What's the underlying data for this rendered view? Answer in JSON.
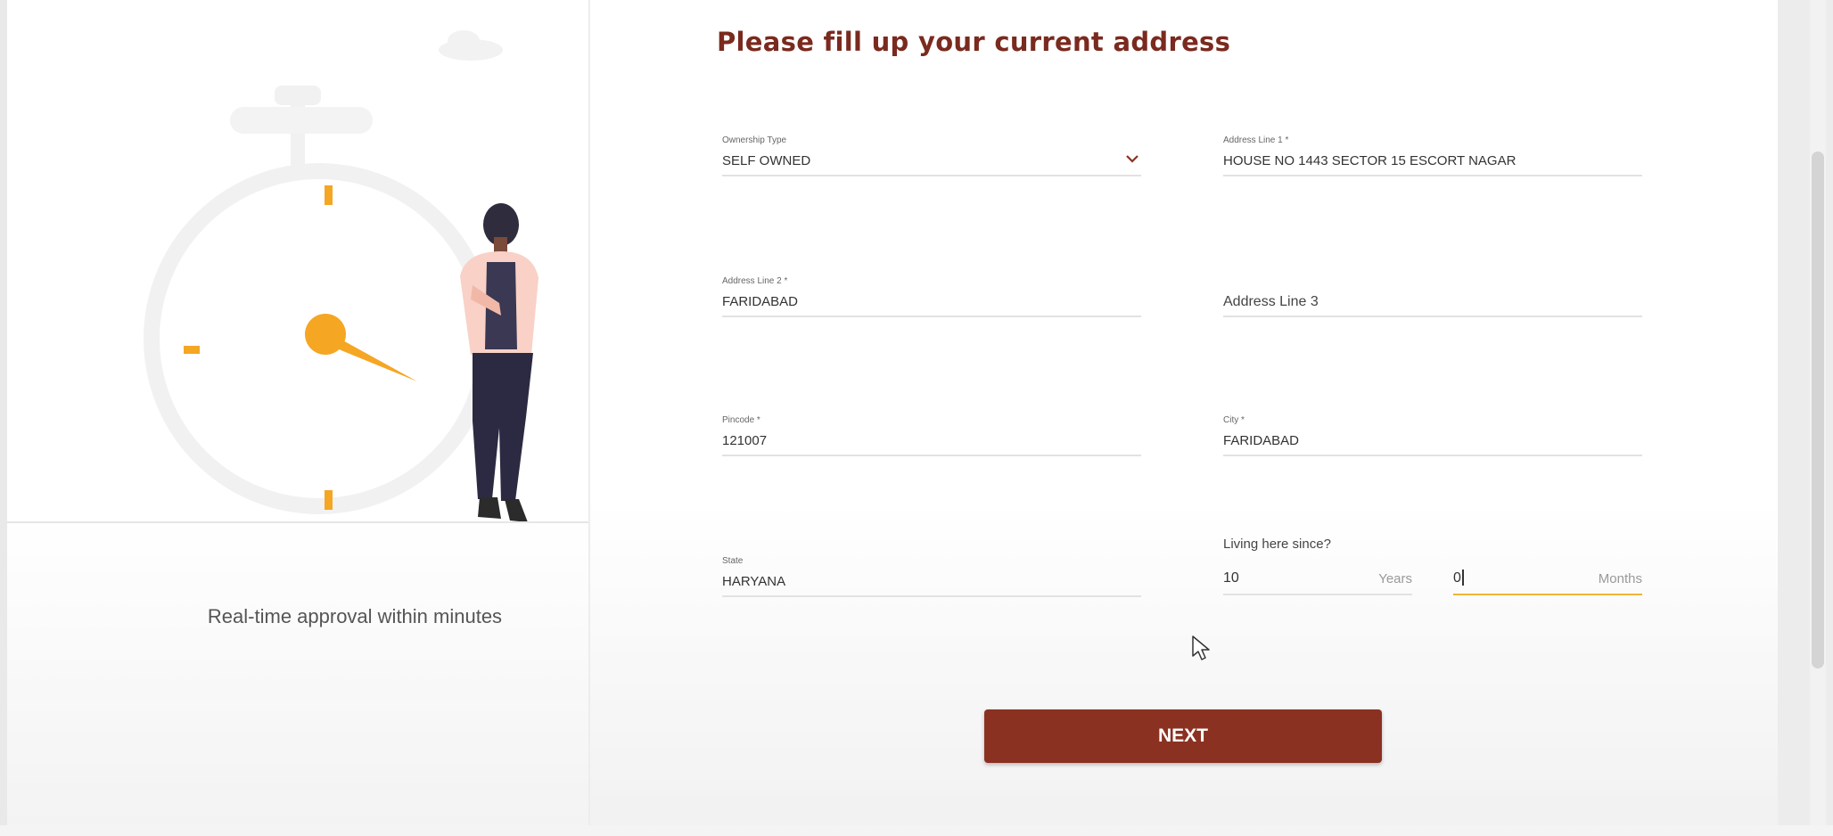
{
  "left_panel": {
    "caption": "Real-time approval within minutes"
  },
  "form": {
    "title": "Please fill up your current address",
    "ownership_type": {
      "label": "Ownership Type",
      "value": "SELF OWNED"
    },
    "address_line_1": {
      "label": "Address Line 1 *",
      "value": "HOUSE NO 1443 SECTOR 15 ESCORT NAGAR"
    },
    "address_line_2": {
      "label": "Address Line 2 *",
      "value": "FARIDABAD"
    },
    "address_line_3": {
      "placeholder": "Address Line 3"
    },
    "pincode": {
      "label": "Pincode *",
      "value": "121007"
    },
    "city": {
      "label": "City *",
      "value": "FARIDABAD"
    },
    "state": {
      "label": "State",
      "value": "HARYANA"
    },
    "living_since": {
      "label": "Living here since?",
      "years_value": "10",
      "years_unit": "Years",
      "months_value": "0",
      "months_unit": "Months"
    },
    "next_label": "NEXT"
  },
  "colors": {
    "title": "#7a2a1e",
    "button": "#8b3122",
    "active_underline": "#f0b33a",
    "illustration_accent": "#f5a623"
  }
}
